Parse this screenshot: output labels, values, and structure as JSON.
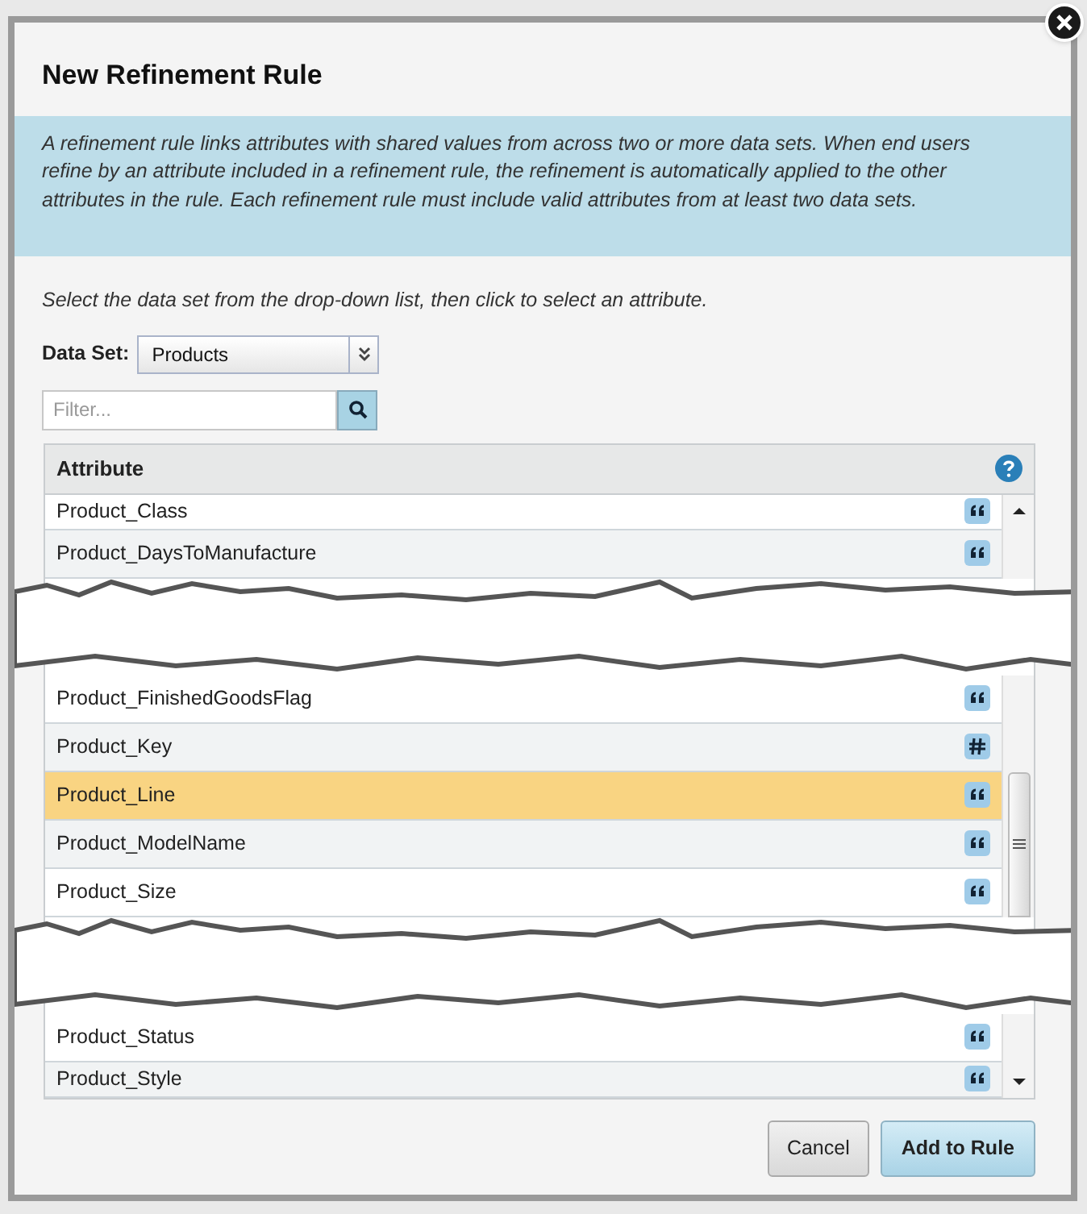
{
  "dialog": {
    "title": "New Refinement Rule",
    "info": "A refinement rule links attributes with shared values from across two or more data sets. When end users refine by an attribute included in a refinement rule, the refinement is automatically applied to the other attributes in the rule. Each refinement rule must include valid attributes from at least two data sets.",
    "instruction": "Select the data set from the drop-down list, then click to select an attribute.",
    "data_set": {
      "label": "Data Set:",
      "value": "Products"
    },
    "filter": {
      "placeholder": "Filter..."
    },
    "table": {
      "column": "Attribute",
      "segments": [
        [
          {
            "name": "Product_Class",
            "kind": "string",
            "selected": false
          },
          {
            "name": "Product_DaysToManufacture",
            "kind": "string",
            "selected": false
          }
        ],
        [
          {
            "name": "Product_FinishedGoodsFlag",
            "kind": "string",
            "selected": false
          },
          {
            "name": "Product_Key",
            "kind": "number",
            "selected": false
          },
          {
            "name": "Product_Line",
            "kind": "string",
            "selected": true
          },
          {
            "name": "Product_ModelName",
            "kind": "string",
            "selected": false
          },
          {
            "name": "Product_Size",
            "kind": "string",
            "selected": false
          }
        ],
        [
          {
            "name": "Product_Status",
            "kind": "string",
            "selected": false
          },
          {
            "name": "Product_Style",
            "kind": "string",
            "selected": false
          }
        ]
      ]
    },
    "buttons": [
      {
        "label": "Cancel",
        "kind": "secondary"
      },
      {
        "label": "Add to Rule",
        "kind": "primary"
      }
    ]
  }
}
